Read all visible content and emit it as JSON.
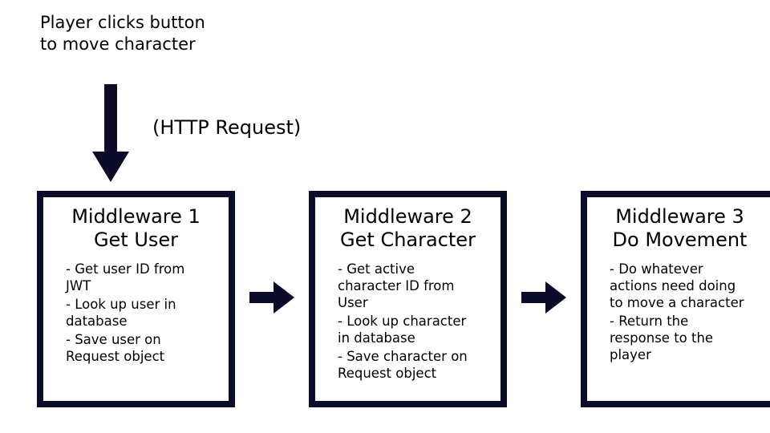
{
  "intro": "Player clicks button to move character",
  "http_label": "(HTTP Request)",
  "color_box_border": "#0b0b2a",
  "arrow_color": "#0b0b2a",
  "boxes": [
    {
      "title_line1": "Middleware 1",
      "title_line2": "Get User",
      "items": [
        "- Get user ID from JWT",
        "- Look up user in database",
        "- Save user on Request object"
      ]
    },
    {
      "title_line1": "Middleware 2",
      "title_line2": "Get Character",
      "items": [
        "- Get active character ID from User",
        "- Look up character in database",
        "- Save character on Request object"
      ]
    },
    {
      "title_line1": "Middleware 3",
      "title_line2": "Do Movement",
      "items": [
        "- Do whatever actions need doing to move a character",
        "- Return the response to the player"
      ]
    }
  ]
}
